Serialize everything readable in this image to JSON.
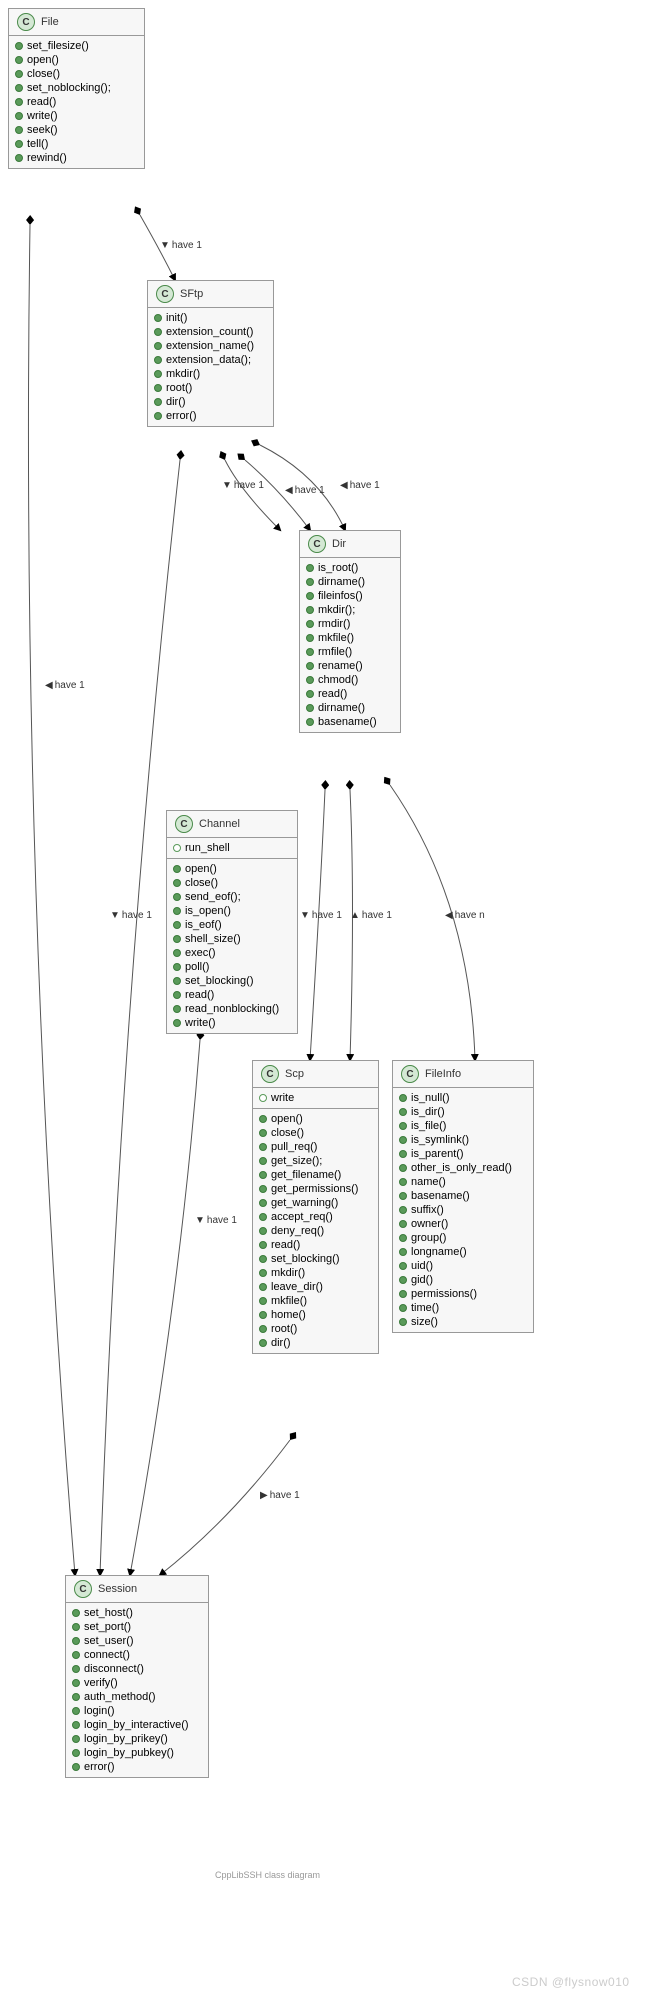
{
  "classes": {
    "file": {
      "name": "File",
      "attrs": [],
      "methods": [
        "set_filesize()",
        "open()",
        "close()",
        "set_noblocking();",
        "read()",
        "write()",
        "seek()",
        "tell()",
        "rewind()"
      ]
    },
    "sftp": {
      "name": "SFtp",
      "attrs": [],
      "methods": [
        "init()",
        "extension_count()",
        "extension_name()",
        "extension_data();",
        "mkdir()",
        "root()",
        "dir()",
        "error()"
      ]
    },
    "dir": {
      "name": "Dir",
      "attrs": [],
      "methods": [
        "is_root()",
        "dirname()",
        "fileinfos()",
        "mkdir();",
        "rmdir()",
        "mkfile()",
        "rmfile()",
        "rename()",
        "chmod()",
        "read()",
        "dirname()",
        "basename()"
      ]
    },
    "channel": {
      "name": "Channel",
      "attrs": [
        "run_shell"
      ],
      "methods": [
        "open()",
        "close()",
        "send_eof();",
        "is_open()",
        "is_eof()",
        "shell_size()",
        "exec()",
        "poll()",
        "set_blocking()",
        "read()",
        "read_nonblocking()",
        "write()"
      ]
    },
    "scp": {
      "name": "Scp",
      "attrs": [
        "write"
      ],
      "methods": [
        "open()",
        "close()",
        "pull_req()",
        "get_size();",
        "get_filename()",
        "get_permissions()",
        "get_warning()",
        "accept_req()",
        "deny_req()",
        "read()",
        "set_blocking()",
        "mkdir()",
        "leave_dir()",
        "mkfile()",
        "home()",
        "root()",
        "dir()"
      ]
    },
    "fileinfo": {
      "name": "FileInfo",
      "attrs": [],
      "methods": [
        "is_null()",
        "is_dir()",
        "is_file()",
        "is_symlink()",
        "is_parent()",
        "other_is_only_read()",
        "name()",
        "basename()",
        "suffix()",
        "owner()",
        "group()",
        "longname()",
        "uid()",
        "gid()",
        "permissions()",
        "time()",
        "size()"
      ]
    },
    "session": {
      "name": "Session",
      "attrs": [],
      "methods": [
        "set_host()",
        "set_port()",
        "set_user()",
        "connect()",
        "disconnect()",
        "verify()",
        "auth_method()",
        "login()",
        "login_by_interactive()",
        "login_by_prikey()",
        "login_by_pubkey()",
        "error()"
      ]
    }
  },
  "edges": {
    "file_sftp": "have 1",
    "sftp_dir1": "have 1",
    "sftp_dir2": "have 1",
    "sftp_dir3": "have 1",
    "file_session": "have 1",
    "sftp_session": "have 1",
    "dir_scp": "have 1",
    "dir_scp2": "have 1",
    "dir_fileinfo": "have n",
    "channel_session": "have 1",
    "scp_session": "have 1"
  },
  "caption": "CppLibSSH class diagram",
  "watermark": "CSDN @flysnow010",
  "icon_letter": "C"
}
